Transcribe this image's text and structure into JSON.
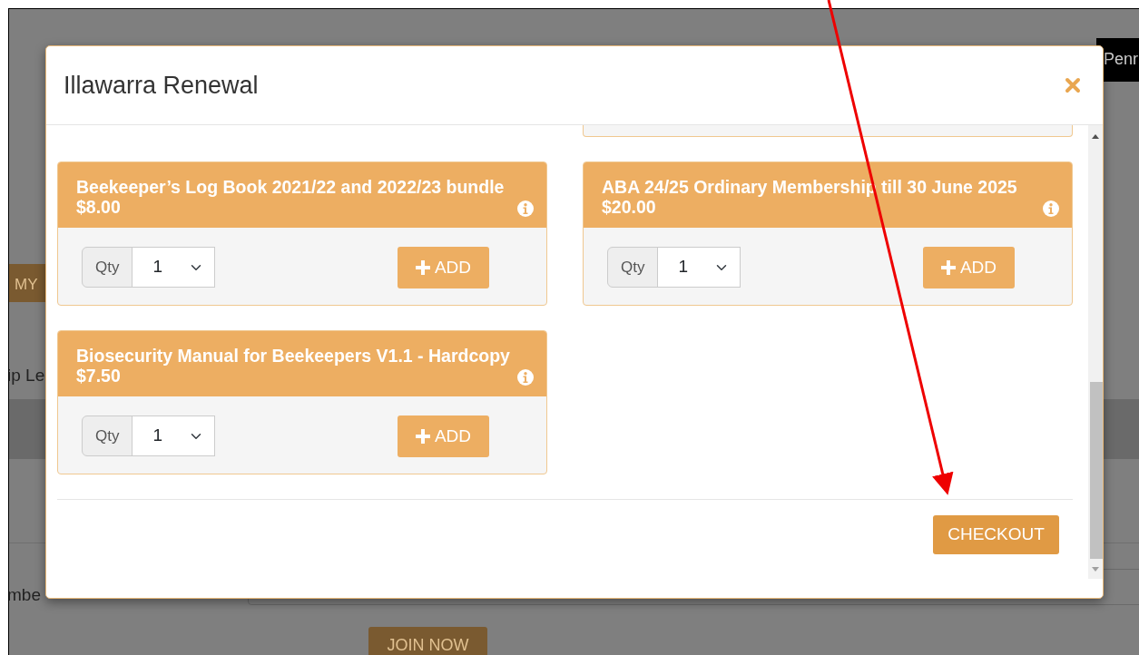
{
  "page": {
    "tab_label": "Penr",
    "my_button": "MY",
    "field_label": "ip Le",
    "select_label": "mbe",
    "join_button": "JOIN NOW"
  },
  "modal": {
    "title": "Illawarra Renewal",
    "products": [
      {
        "name": "Beekeeper’s Log Book 2021/22 and 2022/23 bundle",
        "price": "$8.00",
        "qty_label": "Qty",
        "qty": "1",
        "add_label": "ADD"
      },
      {
        "name": "ABA 24/25 Ordinary Membership till 30 June 2025",
        "price": "$20.00",
        "qty_label": "Qty",
        "qty": "1",
        "add_label": "ADD"
      },
      {
        "name": "Biosecurity Manual for Beekeepers V1.1 - Hardcopy",
        "price": "$7.50",
        "qty_label": "Qty",
        "qty": "1",
        "add_label": "ADD"
      }
    ],
    "checkout": "CHECKOUT"
  }
}
